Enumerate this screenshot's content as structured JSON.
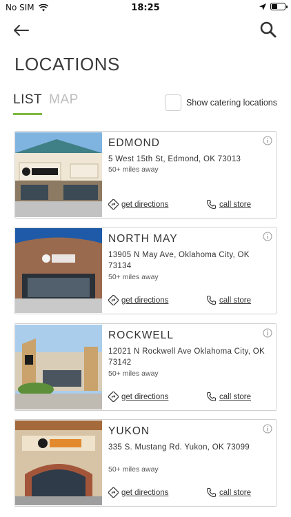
{
  "status_bar": {
    "carrier": "No SIM",
    "time": "18:25"
  },
  "page": {
    "title": "LOCATIONS"
  },
  "tabs": [
    {
      "label": "LIST"
    },
    {
      "label": "MAP"
    }
  ],
  "catering": {
    "label": "Show catering locations"
  },
  "actions": {
    "directions_label": "get directions",
    "call_label": "call store"
  },
  "locations": [
    {
      "name": "EDMOND",
      "address": "5 West 15th St, Edmond, OK 73013",
      "distance": "50+ miles away"
    },
    {
      "name": "NORTH MAY",
      "address": "13905 N May Ave, Oklahoma City, OK 73134",
      "distance": "50+ miles away"
    },
    {
      "name": "ROCKWELL",
      "address": "12021 N Rockwell Ave Oklahoma City, OK 73142",
      "distance": "50+ miles away"
    },
    {
      "name": "YUKON",
      "address": "335 S. Mustang Rd. Yukon, OK 73099",
      "distance": "50+ miles away"
    }
  ],
  "colors": {
    "accent": "#7cba3d",
    "border": "#cfcfcf",
    "text": "#333333"
  },
  "icons": {
    "back": "arrow-left-icon",
    "search": "search-icon",
    "info": "info-icon",
    "directions": "directions-icon",
    "phone": "phone-icon"
  }
}
